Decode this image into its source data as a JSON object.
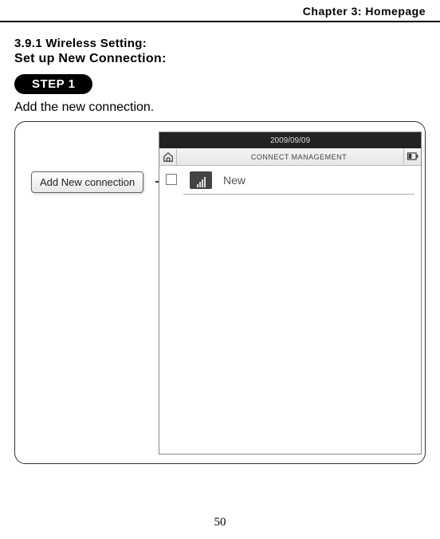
{
  "chapter": "Chapter 3: Homepage",
  "section_number": "3.9.1 Wireless Setting:",
  "section_title": "Set up New Connection:",
  "step_badge": "STEP 1",
  "step_text": "Add the new connection.",
  "callout": "Add New connection",
  "device": {
    "status_date": "2009/09/09",
    "titlebar": "CONNECT MANAGEMENT",
    "list_item": "New"
  },
  "page_number": "50"
}
